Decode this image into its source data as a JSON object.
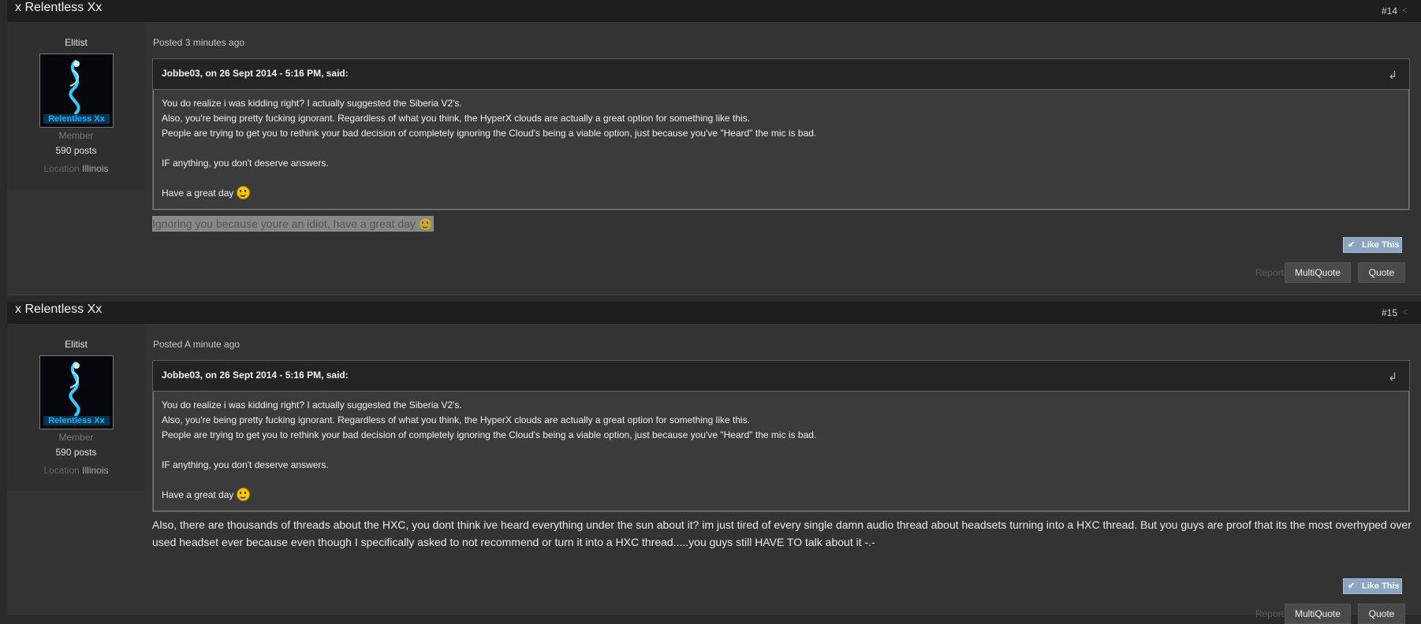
{
  "posts": [
    {
      "author": "x Relentless Xx",
      "number": "#14",
      "rank": "Elitist",
      "avatar_text": "Relentless Xx",
      "group": "Member",
      "post_count": "590 posts",
      "location_label": "Location",
      "location": "Illinois",
      "posted": "Posted 3 minutes ago",
      "quote_cite": "Jobbe03, on 26 Sept 2014 - 5:16 PM, said:",
      "quote_lines": [
        "You do realize i was kidding right? I actually suggested the Siberia V2's.",
        "Also, you're being pretty fucking ignorant. Regardless of what you think, the HyperX clouds are actually a great option for something like this.",
        "People are trying to get you to rethink your bad decision of completely ignoring the Cloud's being a viable option, just because you've \"Heard\" the mic is bad.",
        "",
        "IF anything, you don't deserve answers.",
        "",
        "Have a great day"
      ],
      "reply": "Ignoring you because youre an idiot, have a great day",
      "like_label": "Like This",
      "report_label": "Report",
      "multiquote_label": "MultiQuote",
      "quote_label": "Quote"
    },
    {
      "author": "x Relentless Xx",
      "number": "#15",
      "rank": "Elitist",
      "avatar_text": "Relentless Xx",
      "group": "Member",
      "post_count": "590 posts",
      "location_label": "Location",
      "location": "Illinois",
      "posted": "Posted A minute ago",
      "quote_cite": "Jobbe03, on 26 Sept 2014 - 5:16 PM, said:",
      "quote_lines": [
        "You do realize i was kidding right? I actually suggested the Siberia V2's.",
        "Also, you're being pretty fucking ignorant. Regardless of what you think, the HyperX clouds are actually a great option for something like this.",
        "People are trying to get you to rethink your bad decision of completely ignoring the Cloud's being a viable option, just because you've \"Heard\" the mic is bad.",
        "",
        "IF anything, you don't deserve answers.",
        "",
        "Have a great day"
      ],
      "reply": "Also, there are thousands of threads about the HXC, you dont think ive heard everything under the sun about it? im just tired of every single damn audio thread about headsets turning into a HXC thread. But you guys are proof that its the most overhyped over used headset ever because even though I specifically asked to not recommend or turn it into a HXC thread.....you guys still HAVE TO talk about it -.-",
      "like_label": "Like This",
      "report_label": "Report",
      "multiquote_label": "MultiQuote",
      "quote_label": "Quote"
    }
  ],
  "icons": {
    "share": "share-icon",
    "quote_jump": "quote-arrow-icon",
    "smiley": "smiley-icon",
    "like_check": "checkmark-icon"
  }
}
